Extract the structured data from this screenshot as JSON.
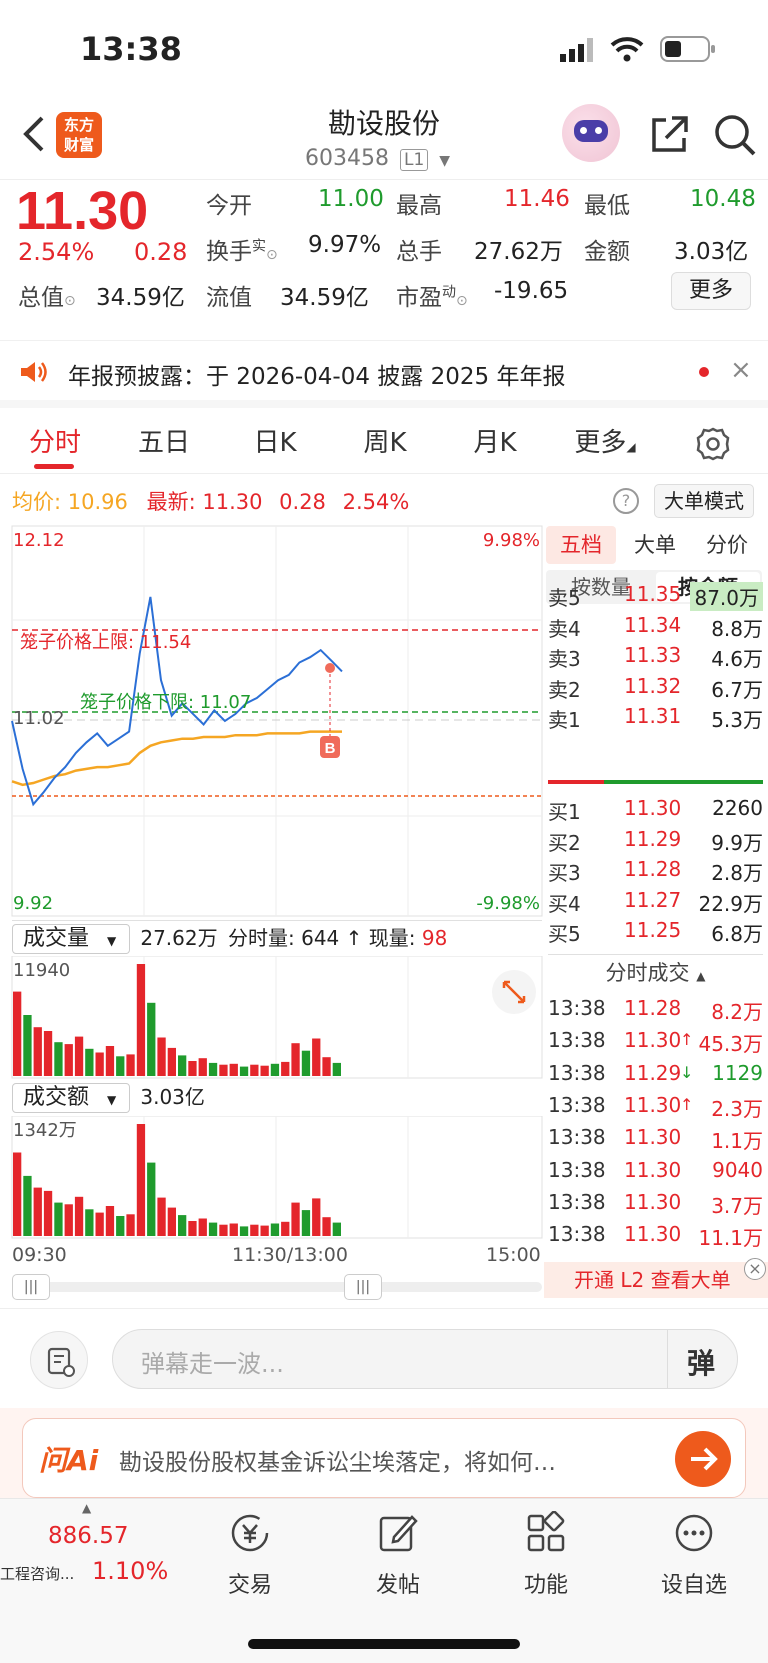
{
  "status": {
    "time": "13:38"
  },
  "header": {
    "logo_line1": "东方",
    "logo_line2": "财富",
    "title": "勘设股份",
    "code": "603458",
    "level": "L1"
  },
  "quote": {
    "price": "11.30",
    "change_pct": "2.54%",
    "change": "0.28",
    "open_label": "今开",
    "open": "11.00",
    "high_label": "最高",
    "high": "11.46",
    "low_label": "最低",
    "low": "10.48",
    "turnover_label": "换手",
    "turnover_sup": "实",
    "turnover": "9.97%",
    "volume_label": "总手",
    "volume": "27.62万",
    "amount_label": "金额",
    "amount": "3.03亿",
    "mktcap_label": "总值",
    "mktcap": "34.59亿",
    "float_label": "流值",
    "float": "34.59亿",
    "pe_label": "市盈",
    "pe_sup": "动",
    "pe": "-19.65",
    "more_button": "更多"
  },
  "notice": {
    "text": "年报预披露：于 2026-04-04 披露 2025 年年报"
  },
  "tabs": [
    "分时",
    "五日",
    "日K",
    "周K",
    "月K",
    "更多"
  ],
  "chart_header": {
    "avg_label": "均价:",
    "avg": "10.96",
    "latest_label": "最新:",
    "latest": "11.30",
    "change": "0.28",
    "pct": "2.54%",
    "mode_button": "大单模式"
  },
  "intraday": {
    "y_max": "12.12",
    "y_min": "9.92",
    "y_mid": "11.02",
    "pct_max": "9.98%",
    "pct_min": "-9.98%",
    "upper_limit_label": "笼子价格上限: 11.54",
    "lower_limit_label": "笼子价格下限: 11.07",
    "b_marker": "B",
    "x_labels": [
      "09:30",
      "11:30/13:00",
      "15:00"
    ]
  },
  "chart_data": [
    {
      "type": "line",
      "title": "分时",
      "ylim": [
        9.92,
        12.12
      ],
      "series": [
        {
          "name": "最新",
          "values": [
            11.02,
            10.75,
            10.55,
            10.62,
            10.7,
            10.76,
            10.84,
            10.9,
            10.95,
            10.88,
            10.92,
            10.96,
            11.4,
            11.72,
            11.25,
            11.05,
            11.12,
            11.06,
            11.0,
            11.08,
            11.02,
            11.06,
            11.12,
            11.15,
            11.2,
            11.25,
            11.28,
            11.35,
            11.38,
            11.42,
            11.36,
            11.3
          ]
        },
        {
          "name": "均价",
          "values": [
            10.68,
            10.66,
            10.67,
            10.69,
            10.71,
            10.72,
            10.74,
            10.75,
            10.76,
            10.76,
            10.77,
            10.78,
            10.84,
            10.88,
            10.9,
            10.91,
            10.92,
            10.92,
            10.93,
            10.93,
            10.93,
            10.94,
            10.94,
            10.94,
            10.95,
            10.95,
            10.95,
            10.95,
            10.96,
            10.96,
            10.96,
            10.96
          ]
        }
      ]
    },
    {
      "type": "bar",
      "title": "成交量",
      "ylim": [
        0,
        11940
      ],
      "values": [
        9000,
        6500,
        5200,
        4800,
        3600,
        3400,
        4200,
        2900,
        2500,
        3200,
        2100,
        2300,
        11940,
        7800,
        4100,
        3000,
        2200,
        1600,
        1900,
        1400,
        1200,
        1300,
        1000,
        1200,
        1100,
        1300,
        1500,
        3500,
        2700,
        4000,
        2000,
        1400
      ]
    },
    {
      "type": "bar",
      "title": "成交额",
      "ylim": [
        0,
        1342
      ],
      "values": [
        1000,
        720,
        580,
        540,
        400,
        380,
        470,
        320,
        280,
        360,
        240,
        260,
        1342,
        880,
        460,
        340,
        250,
        180,
        210,
        160,
        135,
        150,
        115,
        135,
        125,
        150,
        170,
        400,
        310,
        450,
        225,
        160
      ]
    }
  ],
  "volume_panel": {
    "label": "成交量",
    "total": "27.62万",
    "minute_label": "分时量:",
    "minute": "644",
    "now_label": "现量:",
    "now": "98",
    "max": "11940"
  },
  "amount_panel": {
    "label": "成交额",
    "total": "3.03亿",
    "max": "1342万"
  },
  "orderbook": {
    "tabs": [
      "五档",
      "大单",
      "分价"
    ],
    "subtabs": [
      "按数量",
      "按金额"
    ],
    "asks": [
      {
        "label": "卖5",
        "price": "11.35",
        "amt": "87.0万"
      },
      {
        "label": "卖4",
        "price": "11.34",
        "amt": "8.8万"
      },
      {
        "label": "卖3",
        "price": "11.33",
        "amt": "4.6万"
      },
      {
        "label": "卖2",
        "price": "11.32",
        "amt": "6.7万"
      },
      {
        "label": "卖1",
        "price": "11.31",
        "amt": "5.3万"
      }
    ],
    "bids": [
      {
        "label": "买1",
        "price": "11.30",
        "amt": "2260"
      },
      {
        "label": "买2",
        "price": "11.29",
        "amt": "9.9万"
      },
      {
        "label": "买3",
        "price": "11.28",
        "amt": "2.8万"
      },
      {
        "label": "买4",
        "price": "11.27",
        "amt": "22.9万"
      },
      {
        "label": "买5",
        "price": "11.25",
        "amt": "6.8万"
      }
    ]
  },
  "trades": {
    "title": "分时成交",
    "rows": [
      {
        "time": "13:38",
        "price": "11.28",
        "arrow": "",
        "amt": "8.2万"
      },
      {
        "time": "13:38",
        "price": "11.30",
        "arrow": "↑",
        "amt": "45.3万"
      },
      {
        "time": "13:38",
        "price": "11.29",
        "arrow": "↓",
        "amt": "1129"
      },
      {
        "time": "13:38",
        "price": "11.30",
        "arrow": "↑",
        "amt": "2.3万"
      },
      {
        "time": "13:38",
        "price": "11.30",
        "arrow": "",
        "amt": "1.1万"
      },
      {
        "time": "13:38",
        "price": "11.30",
        "arrow": "",
        "amt": "9040"
      },
      {
        "time": "13:38",
        "price": "11.30",
        "arrow": "",
        "amt": "3.7万"
      },
      {
        "time": "13:38",
        "price": "11.30",
        "arrow": "",
        "amt": "11.1万"
      }
    ],
    "banner": "开通 L2 查看大单"
  },
  "comment": {
    "placeholder": "弹幕走一波...",
    "danmu": "弹"
  },
  "ai": {
    "brand": "问Ai",
    "text": "勘设股份股权基金诉讼尘埃落定，将如何…"
  },
  "bottom_nav": {
    "index_value": "886.57",
    "index_name": "工程咨询...",
    "index_pct": "1.10%",
    "items": [
      "交易",
      "发帖",
      "功能",
      "设自选"
    ]
  },
  "colors": {
    "up": "#e4262b",
    "down": "#1f9b2d",
    "price_line": "#2b6fd6",
    "avg_line": "#f5a623",
    "brand": "#ee5a1c"
  }
}
